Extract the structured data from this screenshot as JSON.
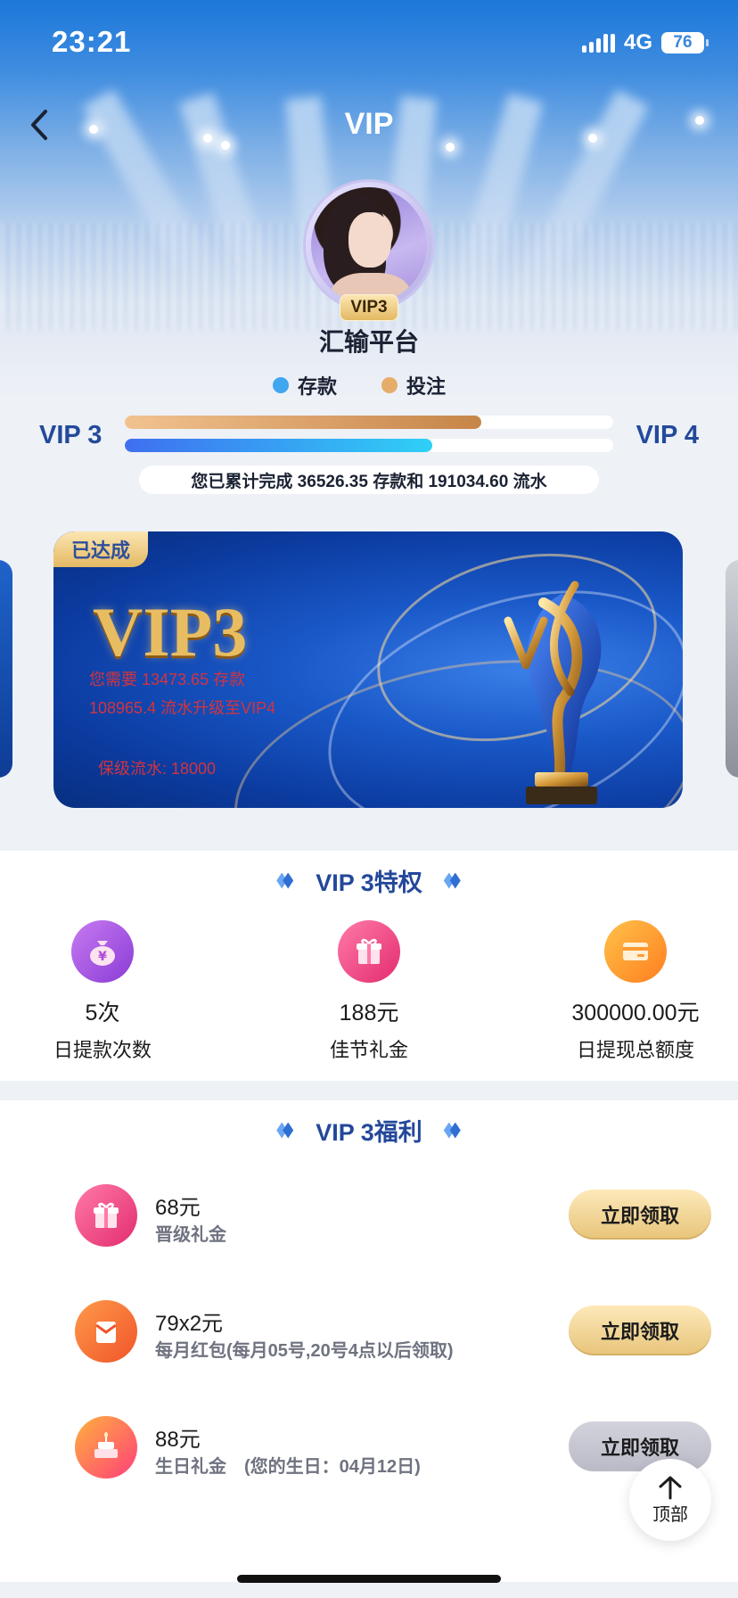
{
  "status_bar": {
    "time": "23:21",
    "network": "4G",
    "battery": "76"
  },
  "nav": {
    "title": "VIP"
  },
  "profile": {
    "vip_badge": "VIP3",
    "platform_name": "汇输平台"
  },
  "legend": {
    "deposit_label": "存款",
    "bet_label": "投注",
    "deposit_color": "#3fa6ef",
    "bet_color": "#e6ac6a"
  },
  "progress": {
    "current_level": "VIP 3",
    "next_level": "VIP 4",
    "bet_progress": 0.73,
    "deposit_progress": 0.63,
    "summary": "您已累计完成 36526.35 存款和 191034.60 流水"
  },
  "card": {
    "reached_tag": "已达成",
    "title": "VIP3",
    "line1": "您需要 13473.65 存款",
    "line2": "108965.4 流水升级至VIP4",
    "line3": "保级流水: 18000"
  },
  "privileges": {
    "title": "VIP 3特权",
    "items": [
      {
        "value": "5次",
        "label": "日提款次数",
        "icon": "money-bag-icon"
      },
      {
        "value": "188元",
        "label": "佳节礼金",
        "icon": "gift-icon"
      },
      {
        "value": "300000.00元",
        "label": "日提现总额度",
        "icon": "card-icon"
      }
    ]
  },
  "benefits": {
    "title": "VIP 3福利",
    "items": [
      {
        "value": "68元",
        "desc": "晋级礼金",
        "button": "立即领取",
        "icon": "gift-icon",
        "enabled": true
      },
      {
        "value": "79x2元",
        "desc": "每月红包(每月05号,20号4点以后领取)",
        "button": "立即领取",
        "icon": "envelope-icon",
        "enabled": true
      },
      {
        "value": "88元",
        "desc": "生日礼金　(您的生日：04月12日)",
        "button": "立即领取",
        "icon": "cake-icon",
        "enabled": false
      }
    ]
  },
  "back_to_top": {
    "label": "顶部"
  }
}
